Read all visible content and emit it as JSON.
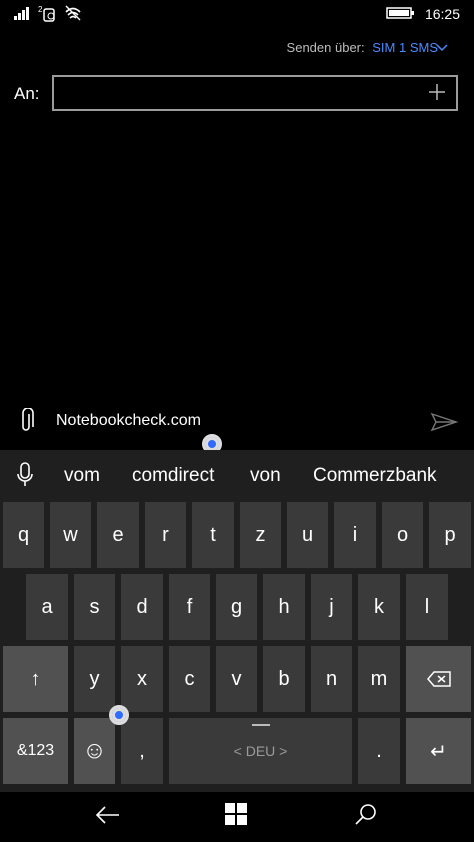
{
  "status_bar": {
    "time": "16:25",
    "icons": [
      "signal-icon",
      "sim-icon",
      "wifi-icon",
      "battery-icon"
    ]
  },
  "header": {
    "send_via_label": "Senden über:",
    "send_via_value": "SIM 1 SMS"
  },
  "recipient": {
    "label": "An:",
    "value": ""
  },
  "compose": {
    "text": "Notebookcheck.com"
  },
  "keyboard": {
    "suggestions": [
      "vom",
      "comdirect",
      "von",
      "Commerzbank"
    ],
    "row1": [
      "q",
      "w",
      "e",
      "r",
      "t",
      "z",
      "u",
      "i",
      "o",
      "p"
    ],
    "row2": [
      "a",
      "s",
      "d",
      "f",
      "g",
      "h",
      "j",
      "k",
      "l"
    ],
    "row3": [
      "y",
      "x",
      "c",
      "v",
      "b",
      "n",
      "m"
    ],
    "shift_label": "↑",
    "numbers_label": "&123",
    "emoji_label": "☺",
    "comma_label": ",",
    "space_label": "< DEU >",
    "period_label": ".",
    "enter_label": "↵"
  },
  "colors": {
    "accent": "#4a8cff",
    "key": "#3a3a3a",
    "key_dark": "#515151",
    "keyboard_bg": "#1f1f1f"
  }
}
